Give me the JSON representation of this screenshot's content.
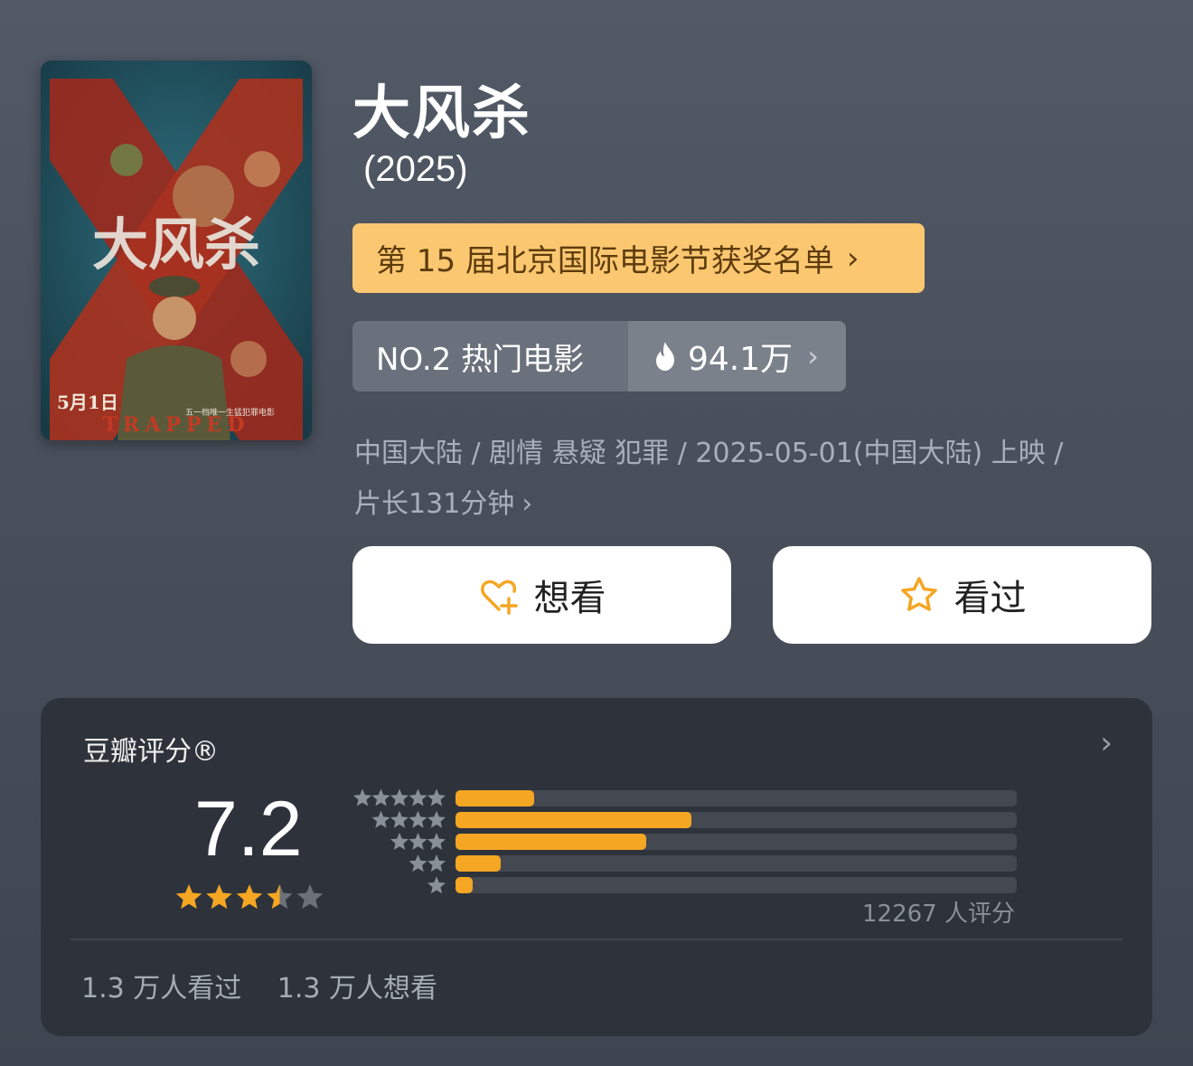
{
  "movie": {
    "title": "大风杀",
    "year": "(2025)",
    "poster": {
      "title_art": "大风杀",
      "date": "5月1日",
      "tagline": "五一档唯一生猛犯罪电影",
      "english": "TRAPPED"
    },
    "award_banner": "第 15 届北京国际电影节获奖名单",
    "rank_label": "NO.2 热门电影",
    "heat_value": "94.1万",
    "meta_line1": "中国大陆 / 剧情 悬疑 犯罪 / 2025-05-01(中国大陆) 上映 /",
    "meta_line2": "片长131分钟"
  },
  "actions": {
    "want_label": "想看",
    "seen_label": "看过"
  },
  "rating": {
    "card_title": "豆瓣评分®",
    "score": "7.2",
    "score_stars": 3.5,
    "distribution_percent": [
      14,
      42,
      34,
      8,
      3
    ],
    "raters": "12267 人评分",
    "seen_count": "1.3 万人看过",
    "want_count": "1.3 万人想看"
  },
  "colors": {
    "accent_orange": "#f5a623",
    "banner_bg": "#fbc771",
    "card_bg": "#2e333b"
  },
  "icons": [
    "heart-plus-icon",
    "star-outline-icon",
    "fire-icon",
    "chevron-right-icon"
  ]
}
